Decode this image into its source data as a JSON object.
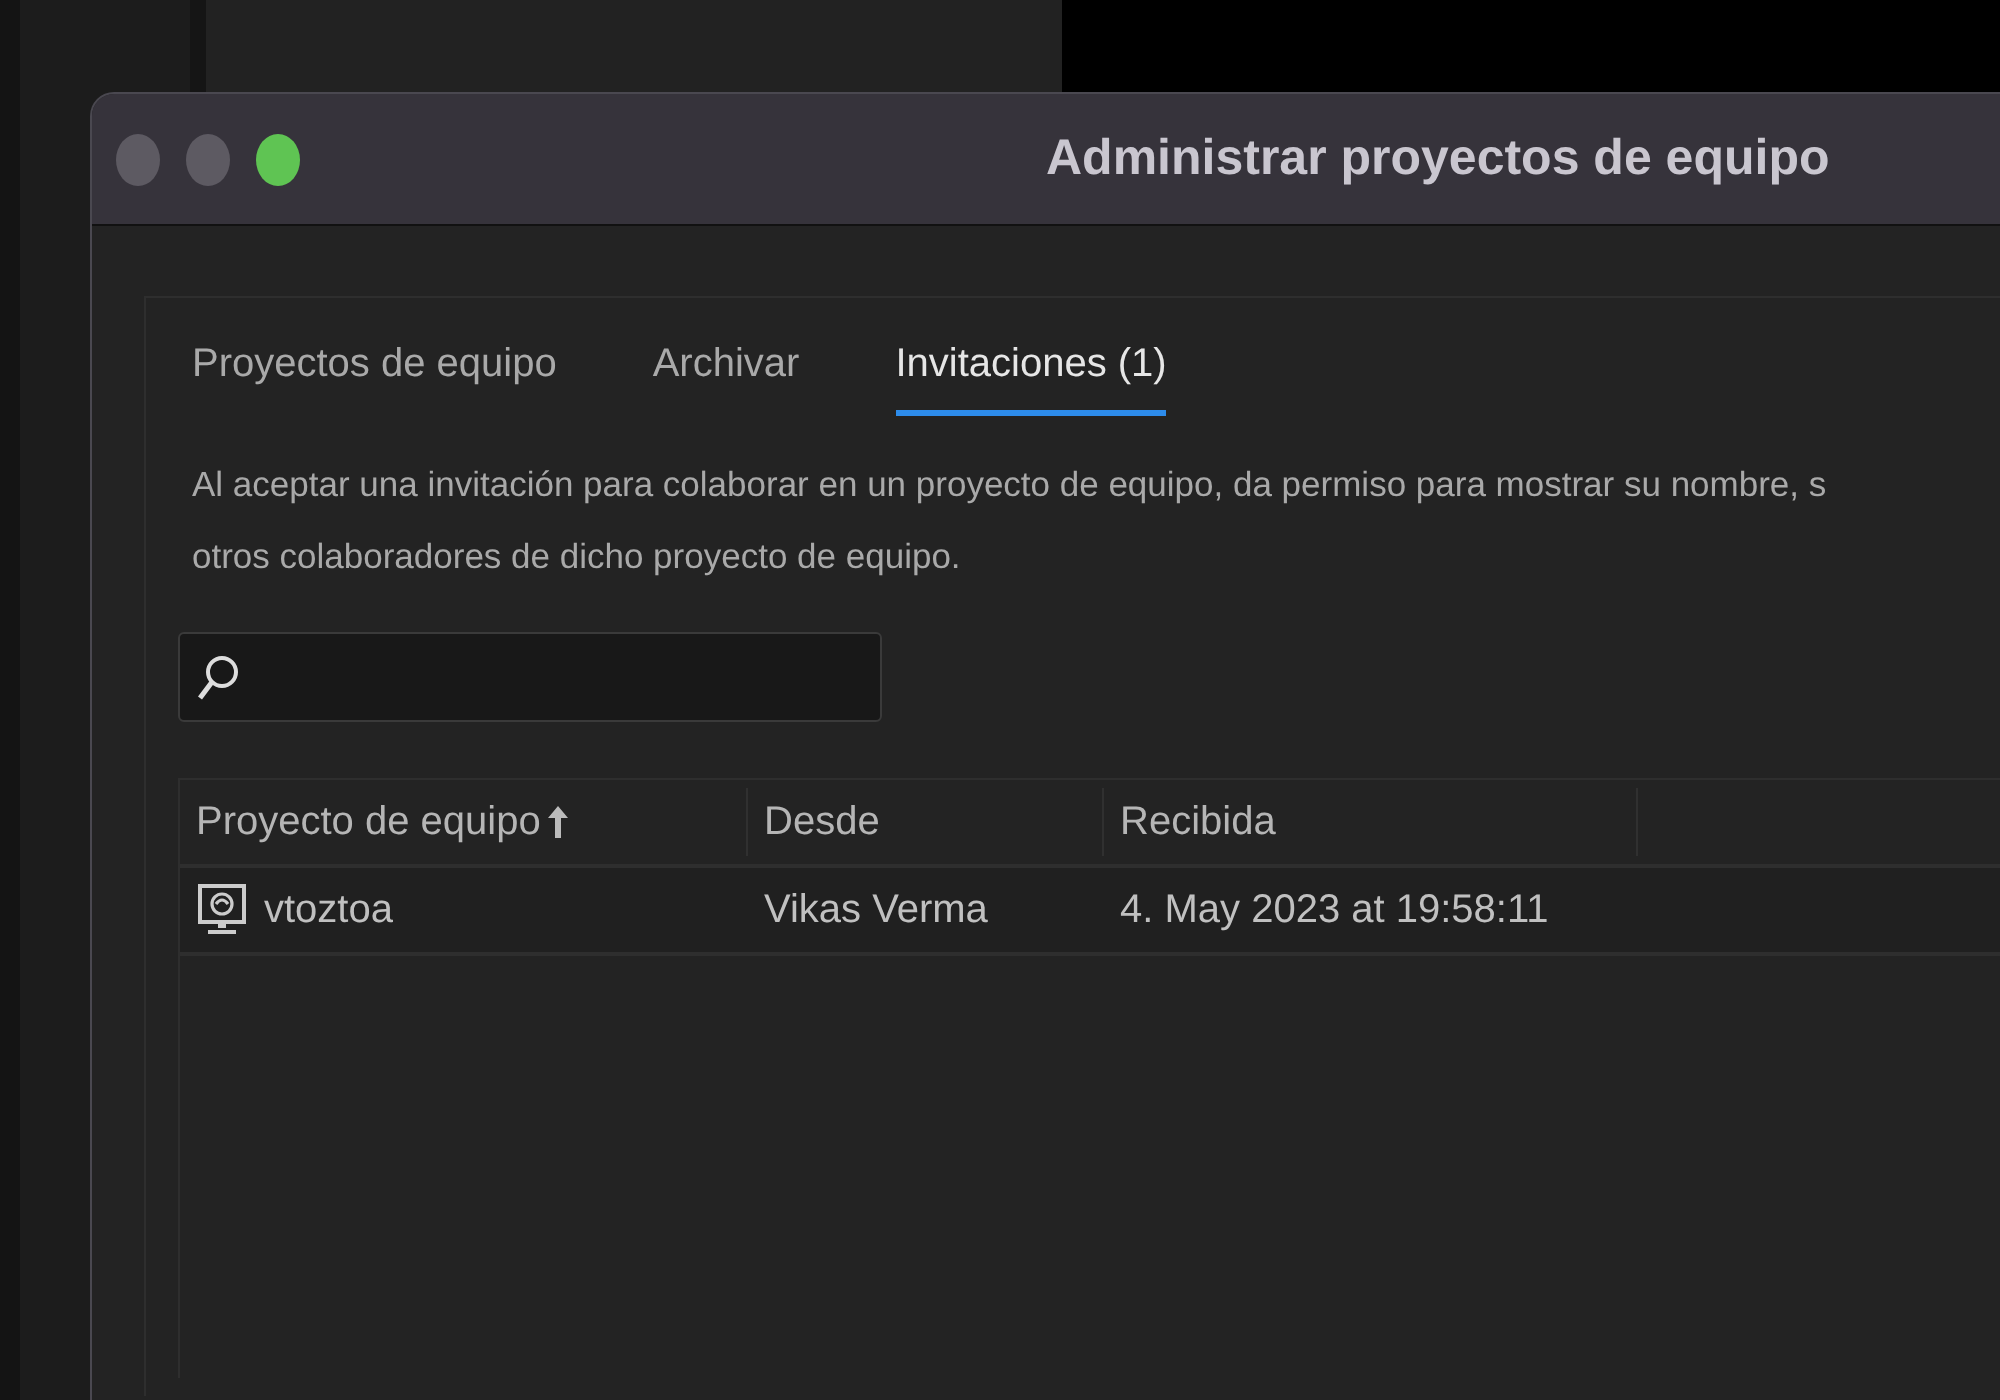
{
  "window": {
    "title": "Administrar proyectos de equipo"
  },
  "tabs": [
    {
      "label": "Proyectos de equipo",
      "selected": false
    },
    {
      "label": "Archivar",
      "selected": false
    },
    {
      "label": "Invitaciones (1)",
      "selected": true
    }
  ],
  "description": [
    "Al aceptar una invitación para colaborar en un proyecto de equipo, da permiso para mostrar su nombre, s",
    "otros colaboradores de dicho proyecto de equipo."
  ],
  "table": {
    "columns": [
      {
        "label": "Proyecto de equipo",
        "sorted": true
      },
      {
        "label": "Desde",
        "sorted": false
      },
      {
        "label": "Recibida",
        "sorted": false
      }
    ],
    "rows": [
      {
        "cells": [
          "vtoztoa",
          "Vikas Verma",
          "4. May 2023 at 19:58:11"
        ]
      }
    ]
  }
}
